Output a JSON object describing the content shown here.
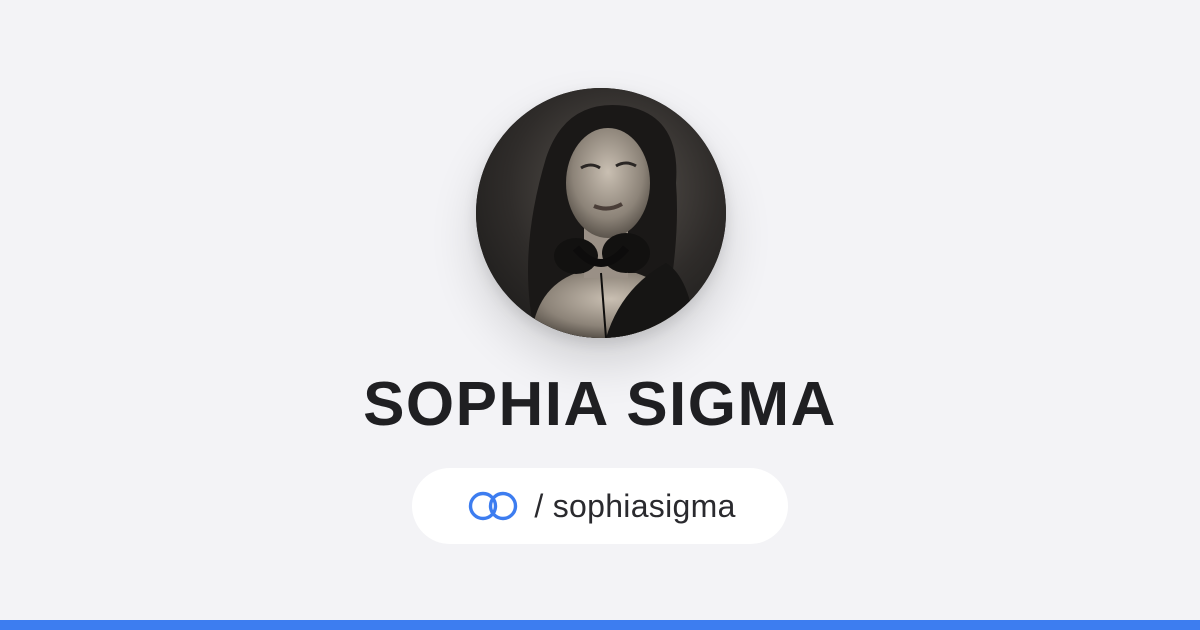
{
  "profile": {
    "name": "SOPHIA SIGMA",
    "avatar_alt": "profile photo",
    "handle_display": "/ sophiasigma"
  },
  "icons": {
    "brand": "linked-rings-logo-icon"
  },
  "colors": {
    "background": "#f3f3f6",
    "accent": "#3d7df0",
    "text": "#1f1f22",
    "pill": "#ffffff"
  }
}
